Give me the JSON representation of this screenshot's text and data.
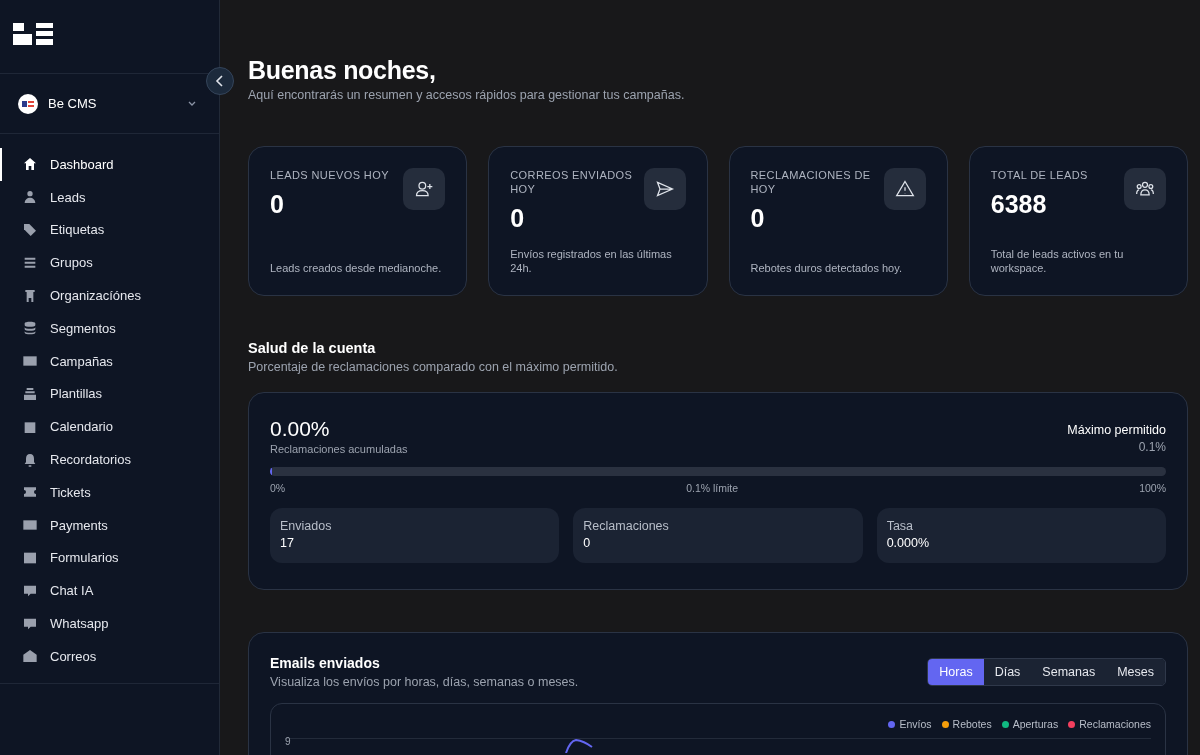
{
  "sidebar": {
    "workspace": {
      "name": "Be CMS"
    },
    "items": [
      {
        "label": "Dashboard",
        "selected": true
      },
      {
        "label": "Leads",
        "selected": false
      },
      {
        "label": "Etiquetas",
        "selected": false
      },
      {
        "label": "Grupos",
        "selected": false
      },
      {
        "label": "Organizacíónes",
        "selected": false
      },
      {
        "label": "Segmentos",
        "selected": false
      },
      {
        "label": "Campañas",
        "selected": false
      },
      {
        "label": "Plantillas",
        "selected": false
      },
      {
        "label": "Calendario",
        "selected": false
      },
      {
        "label": "Recordatorios",
        "selected": false
      },
      {
        "label": "Tickets",
        "selected": false
      },
      {
        "label": "Payments",
        "selected": false
      },
      {
        "label": "Formularios",
        "selected": false
      },
      {
        "label": "Chat IA",
        "selected": false
      },
      {
        "label": "Whatsapp",
        "selected": false
      },
      {
        "label": "Correos",
        "selected": false
      }
    ]
  },
  "header": {
    "greeting": "Buenas noches,",
    "subtitle": "Aquí encontrarás un resumen y accesos rápidos para gestionar tus campañas."
  },
  "stats": [
    {
      "label": "LEADS NUEVOS HOY",
      "value": "0",
      "note": "Leads creados desde medianoche.",
      "kind": "user-plus"
    },
    {
      "label": "CORREOS ENVIADOS HOY",
      "value": "0",
      "note": "Envíos registrados en las últimas 24h.",
      "kind": "send"
    },
    {
      "label": "RECLAMACIONES DE HOY",
      "value": "0",
      "note": "Rebotes duros detectados hoy.",
      "kind": "warning"
    },
    {
      "label": "TOTAL DE LEADS",
      "value": "6388",
      "note": "Total de leads activos en tu workspace.",
      "kind": "users"
    }
  ],
  "health": {
    "title": "Salud de la cuenta",
    "subtitle": "Porcentaje de reclamaciones comparado con el máximo permitido.",
    "value": "0.00%",
    "value_label": "Reclamaciones acumuladas",
    "max_label": "Máximo permitido",
    "max_value": "0.1%",
    "level": 0.002,
    "scale": [
      "0%",
      "0.1% límite",
      "100%"
    ],
    "metrics": [
      {
        "label": "Enviados",
        "value": "17"
      },
      {
        "label": "Reclamaciones",
        "value": "0"
      },
      {
        "label": "Tasa",
        "value": "0.000%"
      }
    ]
  },
  "emails": {
    "title": "Emails enviados",
    "subtitle": "Visualiza los envíos por horas, días, semanas o meses.",
    "tabs": [
      {
        "label": "Horas",
        "selected": true
      },
      {
        "label": "Días",
        "selected": false
      },
      {
        "label": "Semanas",
        "selected": false
      },
      {
        "label": "Meses",
        "selected": false
      }
    ],
    "legend": [
      {
        "label": "Envíos",
        "color": "#6366f1"
      },
      {
        "label": "Rebotes",
        "color": "#f59e0b"
      },
      {
        "label": "Aperturas",
        "color": "#10b981"
      },
      {
        "label": "Reclamaciones",
        "color": "#f43f5e"
      }
    ],
    "y_tick": "9"
  }
}
